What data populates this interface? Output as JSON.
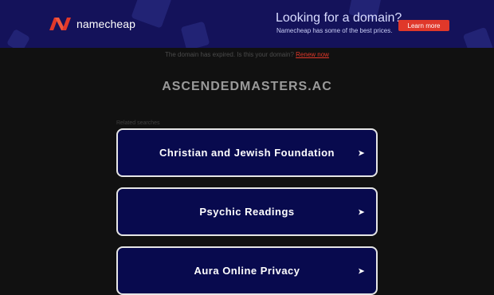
{
  "banner": {
    "brand": "namecheap",
    "promo_title": "Looking for a domain?",
    "promo_sub": "Namecheap has some of the best prices.",
    "cta_label": "Learn more",
    "logo_icon": "namecheap-n-logo-icon",
    "accent": "#e0382a",
    "background": "#14125a"
  },
  "notice": {
    "text": "The domain has expired. Is this your domain?",
    "renew_label": "Renew now"
  },
  "domain_name": "ASCENDEDMASTERS.AC",
  "related": {
    "heading": "Related searches",
    "items": [
      {
        "label": "Christian and Jewish Foundation",
        "arrow": "➤"
      },
      {
        "label": "Psychic Readings",
        "arrow": "➤"
      },
      {
        "label": "Aura Online Privacy",
        "arrow": "➤"
      }
    ]
  }
}
